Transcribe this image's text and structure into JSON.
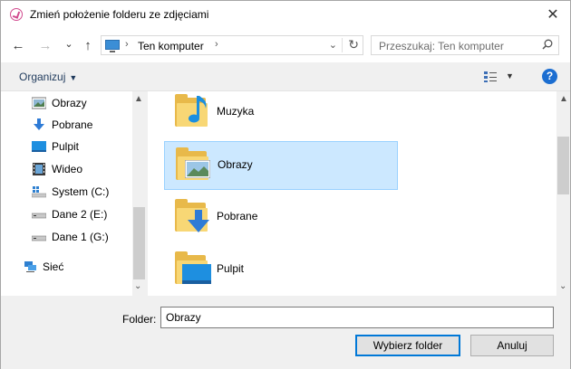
{
  "window": {
    "title": "Zmień położenie folderu ze zdjęciami",
    "close_glyph": "✕"
  },
  "nav": {
    "back_glyph": "←",
    "forward_glyph": "→",
    "recent_glyph": "⌄",
    "up_glyph": "↑",
    "address": {
      "separator": "›",
      "location": "Ten komputer",
      "dropdown": "⌄",
      "refresh": "↻"
    },
    "search": {
      "placeholder": "Przeszukaj: Ten komputer"
    }
  },
  "toolbar": {
    "organize_label": "Organizuj",
    "organize_caret": "▼",
    "view_caret": "▼",
    "help_glyph": "?"
  },
  "sidebar": {
    "items": [
      {
        "label": "Obrazy",
        "icon": "pictures-icon"
      },
      {
        "label": "Pobrane",
        "icon": "downloads-icon"
      },
      {
        "label": "Pulpit",
        "icon": "desktop-icon"
      },
      {
        "label": "Wideo",
        "icon": "video-icon"
      },
      {
        "label": "System (C:)",
        "icon": "system-drive-icon"
      },
      {
        "label": "Dane 2 (E:)",
        "icon": "drive-icon"
      },
      {
        "label": "Dane 1 (G:)",
        "icon": "drive-icon"
      },
      {
        "label": "Sieć",
        "icon": "network-icon"
      }
    ],
    "scroll_up": "▲",
    "scroll_down": "⌄"
  },
  "files": {
    "items": [
      {
        "label": "Muzyka",
        "icon": "music-folder-icon",
        "selected": false
      },
      {
        "label": "Obrazy",
        "icon": "pictures-folder-icon",
        "selected": true
      },
      {
        "label": "Pobrane",
        "icon": "downloads-folder-icon",
        "selected": false
      },
      {
        "label": "Pulpit",
        "icon": "desktop-folder-icon",
        "selected": false
      }
    ],
    "scroll_up": "▲",
    "scroll_down": "⌄"
  },
  "footer": {
    "folder_label": "Folder:",
    "folder_value": "Obrazy",
    "select_button": "Wybierz folder",
    "cancel_button": "Anuluj"
  },
  "colors": {
    "selection": "#cce8ff",
    "selection_border": "#99d1ff",
    "accent": "#0078d7",
    "folder": "#f8d775"
  }
}
